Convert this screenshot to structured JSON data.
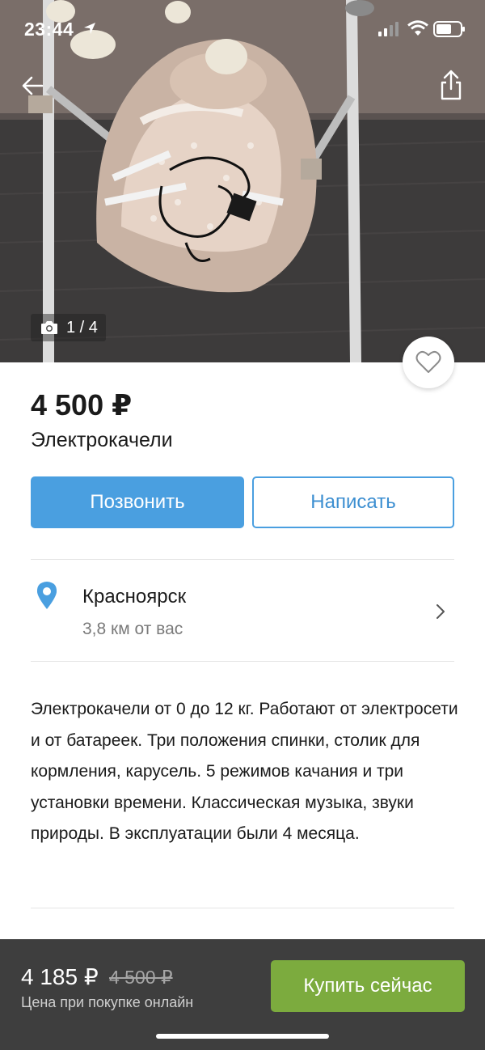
{
  "status_bar": {
    "time": "23:44"
  },
  "photo": {
    "counter": "1 / 4"
  },
  "listing": {
    "price": "4 500 ₽",
    "title": "Электрокачели"
  },
  "actions": {
    "call_label": "Позвонить",
    "write_label": "Написать"
  },
  "location": {
    "city": "Красноярск",
    "distance": "3,8  км от вас"
  },
  "description": "Электрокачели от 0 до 12 кг. Работают от электросети и от батареек. Три положения спинки, столик для кормления, карусель. 5 режимов качания и три установки времени. Классическая музыка, звуки природы. В эксплуатации были 4 месяца.",
  "purchase_bar": {
    "price": "4 185 ₽",
    "old_price": "4 500 ₽",
    "caption": "Цена при покупке онлайн",
    "buy_label": "Купить сейчас"
  },
  "colors": {
    "accent_blue": "#4a9fe0",
    "buy_green": "#7cab3e",
    "bottom_bar_bg": "#3e3e3e"
  },
  "icons": [
    "location-arrow-icon",
    "cellular-signal-icon",
    "wifi-icon",
    "battery-icon",
    "back-arrow-icon",
    "share-icon",
    "camera-icon",
    "heart-icon",
    "map-pin-icon",
    "chevron-right-icon"
  ]
}
